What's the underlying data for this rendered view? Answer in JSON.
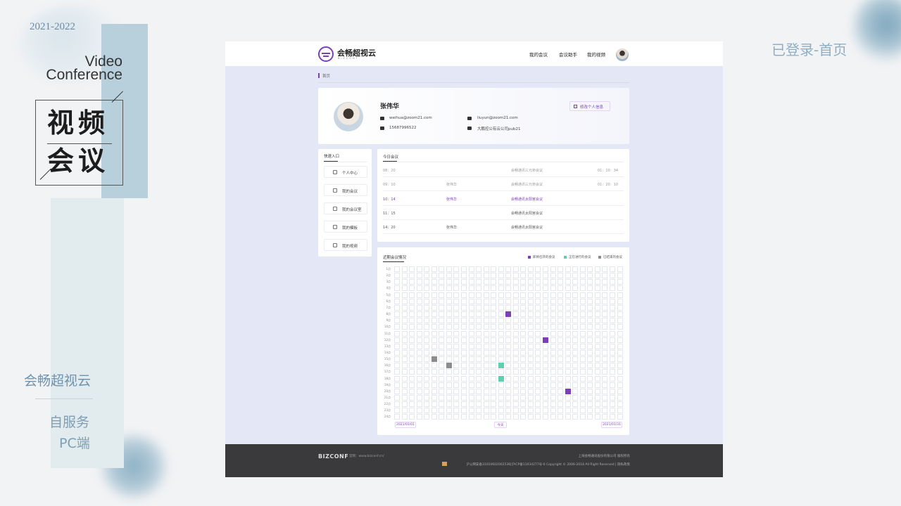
{
  "slide": {
    "year": "2021-2022",
    "english_title_1": "Video",
    "english_title_2": "Conference",
    "cn_title_1": "视频",
    "cn_title_2": "会议",
    "brand": "会畅超视云",
    "subtitle_1": "自服务",
    "subtitle_2": "PC端",
    "page_label": "已登录-首页"
  },
  "app": {
    "logo_text": "会畅超视云",
    "logo_sub": "BIZCONF",
    "nav": [
      "我的会议",
      "会议助手",
      "我的视频"
    ],
    "breadcrumb": "首页"
  },
  "profile": {
    "name": "张伟华",
    "email_1": "weihua@zoom21.com",
    "phone": "15687996522",
    "email_2": "liuyun@zoom21.com",
    "company": "大鹏控公有云公司pub21",
    "edit_label": "修改个人信息"
  },
  "quick": {
    "title": "快速入口",
    "items": [
      "个人中心",
      "我的会议",
      "我的会议室",
      "我的模板",
      "我的视频"
    ]
  },
  "today": {
    "title": "今日会议",
    "rows": [
      {
        "time": "08：20",
        "host": "",
        "meeting": "会畅通讯三元桥会议",
        "duration": "01：10：34",
        "state": "ended"
      },
      {
        "time": "09：10",
        "host": "张伟华",
        "meeting": "会畅通讯三元桥会议",
        "duration": "01：20：10",
        "state": "ended"
      },
      {
        "time": "10：14",
        "host": "张伟华",
        "meeting": "会畅通讯太阳宫会议",
        "duration": "",
        "state": "active"
      },
      {
        "time": "11：15",
        "host": "",
        "meeting": "会畅通讯太阳宫会议",
        "duration": "",
        "state": "upcoming"
      },
      {
        "time": "14：20",
        "host": "张伟华",
        "meeting": "会畅通讯太阳宫会议",
        "duration": "",
        "state": "upcoming"
      }
    ]
  },
  "recent": {
    "title": "近期会议情况",
    "legend": [
      {
        "label": "即将召开的会议",
        "color": "#7b3fb6"
      },
      {
        "label": "正在进行的会议",
        "color": "#5fcfae"
      },
      {
        "label": "已结束的会议",
        "color": "#8c8c8c"
      }
    ],
    "row_labels": [
      "1点",
      "2点",
      "3点",
      "4点",
      "5点",
      "6点",
      "7点",
      "8点",
      "9点",
      "10点",
      "11点",
      "12点",
      "13点",
      "14点",
      "15点",
      "16点",
      "17点",
      "18点",
      "19点",
      "20点",
      "21点",
      "22点",
      "23点",
      "24点"
    ],
    "columns": 31,
    "marked_cells": [
      {
        "row": 8,
        "col": 16,
        "status": "upcoming"
      },
      {
        "row": 12,
        "col": 21,
        "status": "upcoming"
      },
      {
        "row": 15,
        "col": 6,
        "status": "ended"
      },
      {
        "row": 16,
        "col": 8,
        "status": "ended"
      },
      {
        "row": 16,
        "col": 15,
        "status": "ongoing"
      },
      {
        "row": 18,
        "col": 15,
        "status": "ongoing"
      },
      {
        "row": 20,
        "col": 24,
        "status": "upcoming"
      }
    ],
    "status_colors": {
      "upcoming": "#7b3fb6",
      "ongoing": "#5fcfae",
      "ended": "#8c8c8c"
    },
    "start_date": "2021/01/01",
    "today_label": "今天",
    "end_date": "2021/01/31"
  },
  "footer": {
    "logo": "BIZCONF",
    "site": "官网：www.bizconf.cn/",
    "company": "上海会畅通讯股份有限公司 版权所有",
    "icp": "沪公网安备31010602002536|沪ICP备11034277号-6 Copyright © 2006-2018 All Right Reserved  |  隐私政策"
  }
}
